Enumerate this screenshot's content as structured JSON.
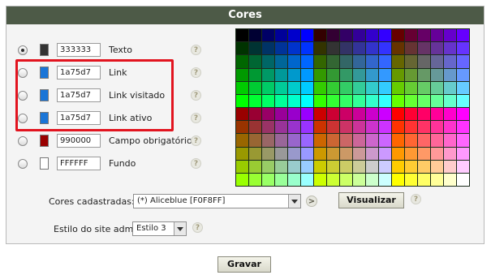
{
  "panel": {
    "title": "Cores"
  },
  "color_rows": [
    {
      "hex": "333333",
      "label": "Texto",
      "swatch": "#333333",
      "selected": true
    },
    {
      "hex": "1a75d7",
      "label": "Link",
      "swatch": "#1a75d7",
      "selected": false
    },
    {
      "hex": "1a75d7",
      "label": "Link visitado",
      "swatch": "#1a75d7",
      "selected": false
    },
    {
      "hex": "1a75d7",
      "label": "Link ativo",
      "swatch": "#1a75d7",
      "selected": false
    },
    {
      "hex": "990000",
      "label": "Campo obrigatório",
      "swatch": "#990000",
      "selected": false
    },
    {
      "hex": "FFFFFF",
      "label": "Fundo",
      "swatch": "#FFFFFF",
      "selected": false
    }
  ],
  "help_glyph": "?",
  "cores_cadastradas": {
    "label": "Cores cadastradas:",
    "selected": "(*) Aliceblue [F0F8FF]",
    "nav_glyph": ">"
  },
  "visualizar_label": "Visualizar",
  "estilo": {
    "label": "Estilo do site adm:",
    "selected": "Estilo 3"
  },
  "gravar_label": "Gravar",
  "highlight_color": "#e2141f",
  "header_color": "#4d5a47"
}
